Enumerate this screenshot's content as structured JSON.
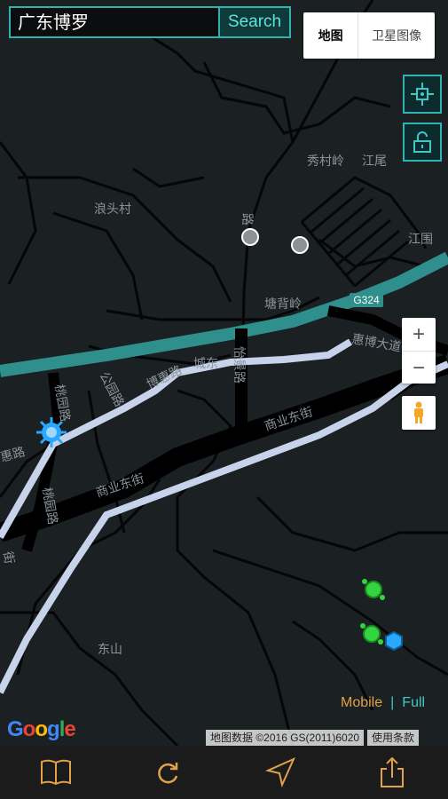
{
  "search": {
    "value": "广东博罗",
    "button_label": "Search"
  },
  "map_type": {
    "map_label": "地图",
    "satellite_label": "卫星图像"
  },
  "map_labels": {
    "xiucunling": "秀村岭",
    "jiangwei": "江尾",
    "langtoucun": "浪头村",
    "jiangwei2": "江围",
    "tangbeiling": "塘背岭",
    "g324": "G324",
    "huibodadao": "惠博大道",
    "yijinglu": "怡景路",
    "bohuilu": "博惠路",
    "chengdong": "城东",
    "gongyuanlu": "公园路",
    "taoyuanlu": "桃园路",
    "shangyedongjie": "商业东街",
    "huilu": "惠路",
    "jie": "街",
    "dongshan": "东山",
    "road_top": "路"
  },
  "links": {
    "mobile": "Mobile",
    "separator": "|",
    "full": "Full"
  },
  "google_logo": "Google",
  "attribution": {
    "data": "地图数据 ©2016 GS(2011)6020",
    "terms": "使用条款"
  },
  "colors": {
    "accent": "#2fb3b0",
    "map_bg": "#1b2023",
    "road": "#000000",
    "highlight_road": "#c7d3ea",
    "highway": "#2e8f8d",
    "green_portal": "#34d640",
    "blue_portal": "#2aa7ff"
  },
  "icons": {
    "target": "crosshair-target-icon",
    "lock": "unlock-icon",
    "pegman": "pegman-icon",
    "book": "book-icon",
    "refresh": "refresh-icon",
    "navigate": "navigation-arrow-icon",
    "share": "share-icon"
  }
}
